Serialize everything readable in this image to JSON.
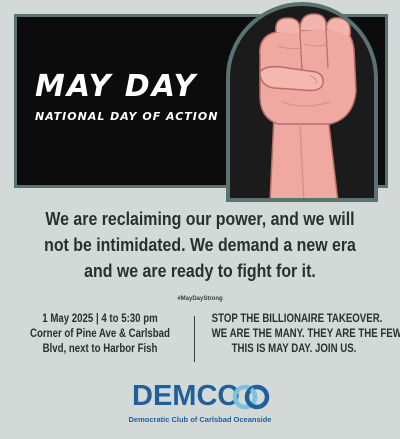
{
  "banner": {
    "title": "MAY DAY",
    "subtitle": "NATIONAL DAY OF ACTION",
    "image": "raised-fist"
  },
  "statement": "We are reclaiming our power, and we will not be intimidated. We demand a new era and we are ready to fight for it.",
  "hashtag": "#MayDayStrong",
  "event": {
    "line1": "1 May 2025 | 4 to 5:30 pm",
    "line2": "Corner of Pine Ave & Carlsbad",
    "line3": "Blvd, next to Harbor Fish"
  },
  "slogan": {
    "line1": "STOP THE BILLIONAIRE TAKEOVER.",
    "line2": "WE ARE THE MANY. THEY ARE THE FEW.",
    "line3": "THIS IS MAY DAY. JOIN US."
  },
  "logo": {
    "wordmark": "DEMCO",
    "org_name": "Democratic Club of Carlsbad Oceanside"
  },
  "colors": {
    "background": "#d3d9d7",
    "banner": "#0c0c0c",
    "border": "#5b7272",
    "skin": "#f0a9a1",
    "brand": "#1f5f9b",
    "accent": "#7ac2e0"
  }
}
